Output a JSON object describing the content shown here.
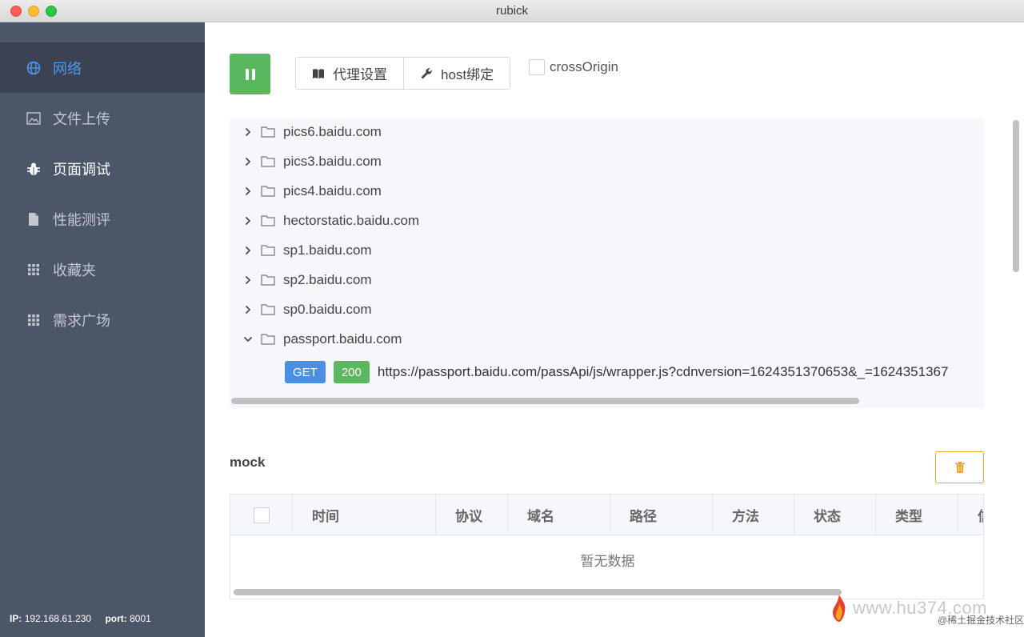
{
  "window": {
    "title": "rubick"
  },
  "sidebar": {
    "items": [
      {
        "label": "网络",
        "icon": "globe-icon",
        "state": "active"
      },
      {
        "label": "文件上传",
        "icon": "image-icon",
        "state": "normal"
      },
      {
        "label": "页面调试",
        "icon": "bug-icon",
        "state": "bright"
      },
      {
        "label": "性能测评",
        "icon": "file-icon",
        "state": "normal"
      },
      {
        "label": "收藏夹",
        "icon": "grid-icon",
        "state": "normal"
      },
      {
        "label": "需求广场",
        "icon": "grid-icon",
        "state": "normal"
      }
    ],
    "footer": {
      "ip_label": "IP:",
      "ip_value": "192.168.61.230",
      "port_label": "port:",
      "port_value": "8001"
    }
  },
  "toolbar": {
    "pause_icon": "pause-icon",
    "proxy_label": "代理设置",
    "host_label": "host绑定",
    "cross_origin_label": "crossOrigin",
    "cross_origin_checked": false
  },
  "tree": {
    "rows": [
      {
        "label": "pics6.baidu.com",
        "expanded": false
      },
      {
        "label": "pics3.baidu.com",
        "expanded": false
      },
      {
        "label": "pics4.baidu.com",
        "expanded": false
      },
      {
        "label": "hectorstatic.baidu.com",
        "expanded": false
      },
      {
        "label": "sp1.baidu.com",
        "expanded": false
      },
      {
        "label": "sp2.baidu.com",
        "expanded": false
      },
      {
        "label": "sp0.baidu.com",
        "expanded": false
      },
      {
        "label": "passport.baidu.com",
        "expanded": true
      }
    ],
    "request": {
      "method": "GET",
      "status": "200",
      "url": "https://passport.baidu.com/passApi/js/wrapper.js?cdnversion=1624351370653&_=1624351367"
    }
  },
  "mock": {
    "title": "mock",
    "columns": [
      "时间",
      "协议",
      "域名",
      "路径",
      "方法",
      "状态",
      "类型",
      "信"
    ],
    "empty_text": "暂无数据"
  },
  "watermark": {
    "text": "www.hu374.com",
    "sub": "@稀土掘金技术社区"
  },
  "colors": {
    "sidebar": "#4c5669",
    "sidebar_active": "#3a4254",
    "accent": "#4c9cf0",
    "green": "#59b85d",
    "get_blue": "#4a90e2",
    "warning": "#f0a52a"
  }
}
